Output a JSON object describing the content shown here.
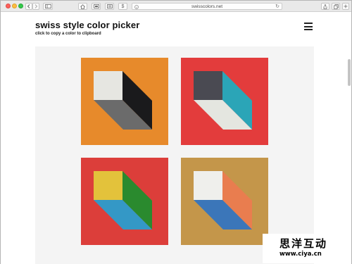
{
  "browser": {
    "url": "swisscolors.net",
    "reload_icon": "↻",
    "toolbar_icons": [
      "back-icon",
      "forward-icon",
      "sidebar-icon",
      "home-icon",
      "screen-icon",
      "reader-icon",
      "dollar-icon",
      "info-icon",
      "reload-icon",
      "share-icon",
      "tabs-icon",
      "new-tab-icon"
    ],
    "dollar_glyph": "$"
  },
  "page": {
    "title": "swiss style color picker",
    "subtitle": "click to copy a color to clipboard",
    "menu_icon": "hamburger-icon"
  },
  "palettes": [
    {
      "name": "orange-palette",
      "colors": {
        "bg": "#e78a2b",
        "top": "#e6e6e1",
        "right": "#1a1a1c",
        "bottom": "#6b6b6b"
      }
    },
    {
      "name": "red-teal-palette",
      "colors": {
        "bg": "#e33c3c",
        "top": "#4a4a52",
        "right": "#2ba5b7",
        "bottom": "#e4e6e0"
      }
    },
    {
      "name": "red-yellow-palette",
      "colors": {
        "bg": "#dc3e3a",
        "top": "#e3c23b",
        "right": "#2a8a2e",
        "bottom": "#3498c6"
      }
    },
    {
      "name": "ochre-palette",
      "colors": {
        "bg": "#c4964a",
        "top": "#efefec",
        "right": "#e97d4f",
        "bottom": "#3b76b9"
      }
    }
  ],
  "watermark": {
    "chinese": "思洋互动",
    "url": "www.ciya.cn"
  }
}
